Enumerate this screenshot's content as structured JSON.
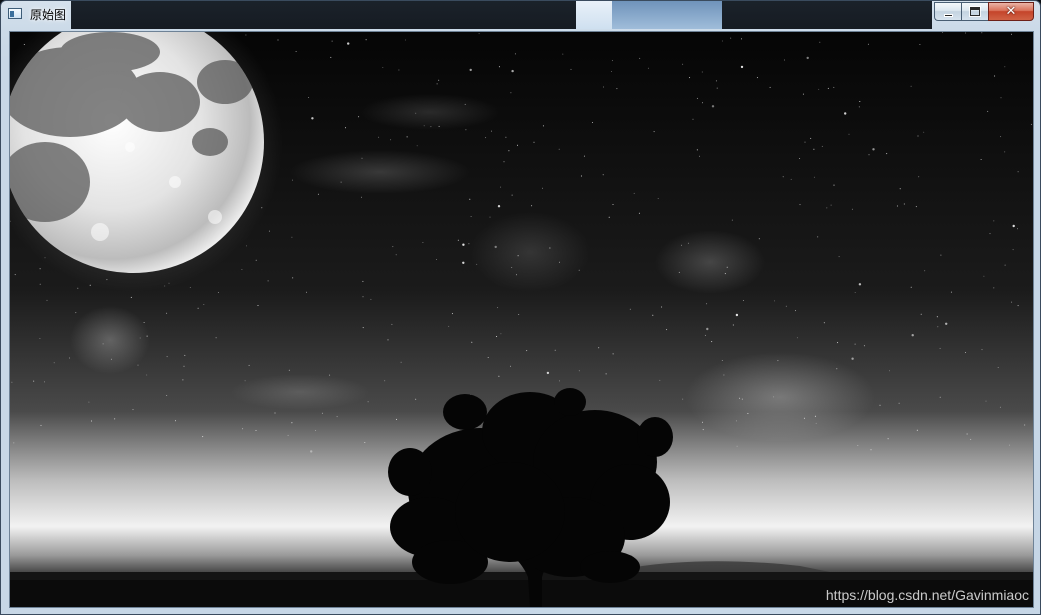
{
  "window": {
    "title": "原始图",
    "close_glyph": "✕"
  },
  "icons": {
    "app": "app-window-icon",
    "minimize": "minimize-icon",
    "maximize": "maximize-icon",
    "close": "close-icon"
  },
  "image": {
    "watermark": "https://blog.csdn.net/Gavinmiaoc"
  },
  "colors": {
    "titlebar_glass": "#c6d6e6",
    "close_button": "#c4442a",
    "image_sky": "#050505"
  }
}
